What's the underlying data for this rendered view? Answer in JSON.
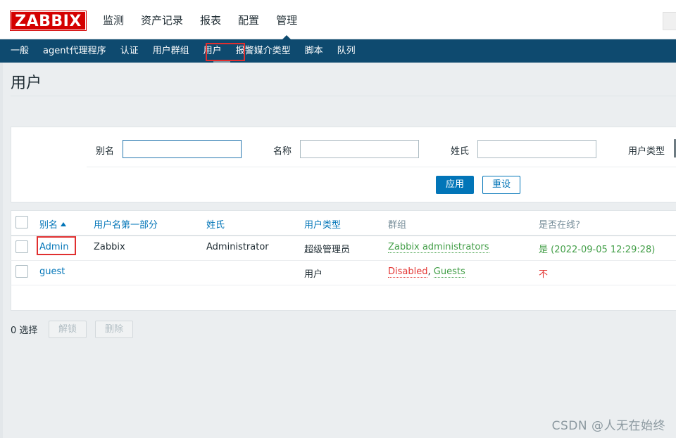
{
  "header": {
    "logo": "ZABBIX",
    "main_menu": [
      "监测",
      "资产记录",
      "报表",
      "配置",
      "管理"
    ],
    "active_menu": "管理"
  },
  "submenu": {
    "items": [
      "一般",
      "agent代理程序",
      "认证",
      "用户群组",
      "用户",
      "报警媒介类型",
      "脚本",
      "队列"
    ],
    "selected": "用户"
  },
  "page": {
    "title": "用户"
  },
  "filter": {
    "alias_label": "别名",
    "alias_value": "",
    "name_label": "名称",
    "name_value": "",
    "surname_label": "姓氏",
    "surname_value": "",
    "usertype_label": "用户类型",
    "apply_label": "应用",
    "reset_label": "重设"
  },
  "table": {
    "headers": {
      "alias": "别名",
      "name": "用户名第一部分",
      "surname": "姓氏",
      "usertype": "用户类型",
      "groups": "群组",
      "online": "是否在线?"
    },
    "rows": [
      {
        "alias": "Admin",
        "name": "Zabbix",
        "surname": "Administrator",
        "usertype": "超级管理员",
        "groups": [
          "Zabbix administrators"
        ],
        "online": "是 (2022-09-05 12:29:28)"
      },
      {
        "alias": "guest",
        "name": "",
        "surname": "",
        "usertype": "用户",
        "groups_disabled": "Disabled",
        "groups_sep": ",",
        "groups_other": "Guests",
        "online": "不"
      }
    ]
  },
  "footer": {
    "selected_count": "0 选择",
    "unblock_label": "解锁",
    "delete_label": "删除"
  },
  "watermark": "CSDN @人无在始终",
  "colors": {
    "brand_red": "#d40000",
    "submenu_bg": "#0e4a6f",
    "link_blue": "#0275b8",
    "online_green": "#429e47",
    "offline_red": "#e33734",
    "highlight_box": "#e02f2f"
  }
}
